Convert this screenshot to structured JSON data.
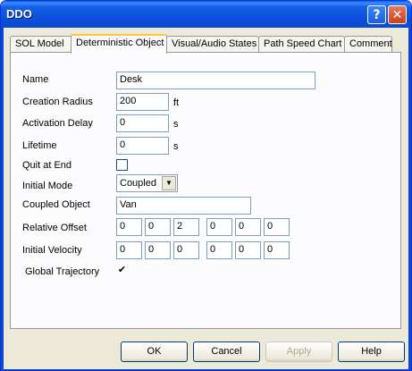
{
  "window": {
    "title": "DDO"
  },
  "tabs": [
    {
      "label": "SOL Model"
    },
    {
      "label": "Deterministic Object"
    },
    {
      "label": "Visual/Audio States"
    },
    {
      "label": "Path Speed Chart"
    },
    {
      "label": "Comment"
    }
  ],
  "form": {
    "name": {
      "label": "Name",
      "value": "Desk"
    },
    "creation_radius": {
      "label": "Creation Radius",
      "value": "200",
      "unit": "ft"
    },
    "activation_delay": {
      "label": "Activation Delay",
      "value": "0",
      "unit": "s"
    },
    "lifetime": {
      "label": "Lifetime",
      "value": "0",
      "unit": "s"
    },
    "quit_at_end": {
      "label": "Quit at End",
      "checked": false
    },
    "initial_mode": {
      "label": "Initial Mode",
      "value": "Coupled"
    },
    "coupled_object": {
      "label": "Coupled Object",
      "value": "Van"
    },
    "relative_offset": {
      "label": "Relative Offset",
      "values": [
        "0",
        "0",
        "2",
        "0",
        "0",
        "0"
      ]
    },
    "initial_velocity": {
      "label": "Initial Velocity",
      "values": [
        "0",
        "0",
        "0",
        "0",
        "0",
        "0"
      ]
    },
    "global_trajectory": {
      "label": "Global Trajectory",
      "checked": true,
      "check_glyph": "✔"
    }
  },
  "buttons": {
    "ok": "OK",
    "cancel": "Cancel",
    "apply": "Apply",
    "help": "Help"
  },
  "titlebar_buttons": {
    "help": "?",
    "close": "✕"
  },
  "combo_arrow": "▼"
}
